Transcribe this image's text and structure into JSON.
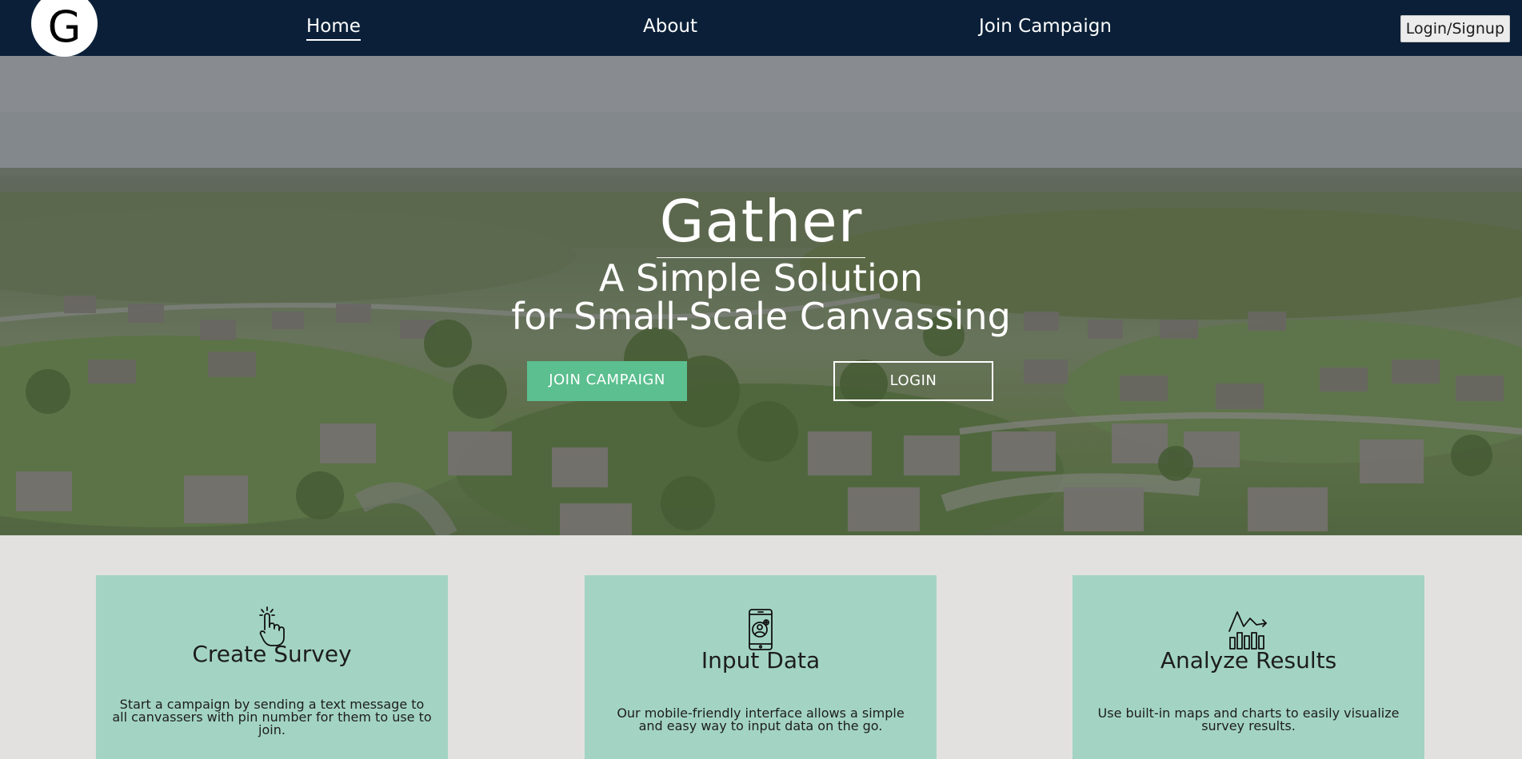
{
  "nav": {
    "logo_letter": "G",
    "links": [
      {
        "label": "Home",
        "active": true
      },
      {
        "label": "About",
        "active": false
      },
      {
        "label": "Join Campaign",
        "active": false
      }
    ],
    "login_label": "Login/Signup"
  },
  "hero": {
    "title": "Gather",
    "subtitle_line1": "A Simple Solution",
    "subtitle_line2": "for Small-Scale Canvassing",
    "join_button": "JOIN CAMPAIGN",
    "login_button": "LOGIN"
  },
  "features": [
    {
      "icon": "pointing-hand-icon",
      "title": "Create Survey",
      "description": "Start a campaign by sending a text message to all canvassers with pin number for them to use to join."
    },
    {
      "icon": "mobile-user-icon",
      "title": "Input Data",
      "description": "Our mobile-friendly interface allows a simple and easy way to input data on the go."
    },
    {
      "icon": "bar-chart-trend-icon",
      "title": "Analyze Results",
      "description": "Use built-in maps and charts to easily visualize survey results."
    }
  ],
  "colors": {
    "navbar": "#0b2038",
    "accent_green": "#5bbf8f",
    "card_bg": "#a3d4c3",
    "page_bg": "#e2e1df"
  }
}
